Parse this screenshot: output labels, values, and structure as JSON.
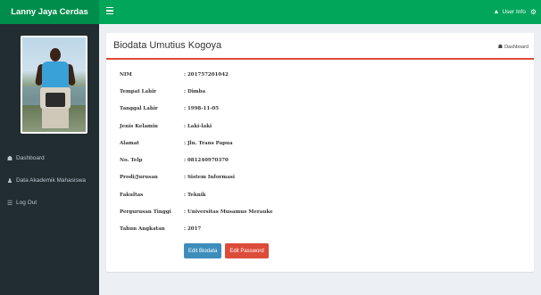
{
  "app": {
    "brand": "Lanny Jaya Cerdas"
  },
  "header": {
    "user_icon": "user-icon",
    "user_label": "User Info",
    "gear_icon": "gear-icon"
  },
  "sidebar": {
    "items": [
      {
        "icon": "dashboard-icon",
        "glyph": "☗",
        "label": "Dashboard"
      },
      {
        "icon": "users-icon",
        "glyph": "👥",
        "label": "Data Akademik Mahasiswa"
      },
      {
        "icon": "list-icon",
        "glyph": "☰",
        "label": "Log Out"
      }
    ]
  },
  "main": {
    "title": "Biodata Umutius Kogoya",
    "breadcrumb": {
      "icon": "dashboard-icon",
      "label": "Dashboard"
    },
    "fields": [
      {
        "label": "NIM",
        "value": ": 201757201042"
      },
      {
        "label": "Tempat Lahir",
        "value": ": Dimba"
      },
      {
        "label": "Tanggal Lahir",
        "value": ": 1998-11-05"
      },
      {
        "label": "Jenis Kelamin",
        "value": ": Laki-laki"
      },
      {
        "label": "Alamat",
        "value": ": Jln. Trans Papua"
      },
      {
        "label": "No. Telp",
        "value": ": 081240970370"
      },
      {
        "label": "Prodi/Jurusan",
        "value": ": Sistem Informasi"
      },
      {
        "label": "Fakultas",
        "value": ": Teknik"
      },
      {
        "label": "Pergurusan Tinggi",
        "value": ": Universitas Musamus Merauke"
      },
      {
        "label": "Tahun Angkatan",
        "value": ": 2017"
      }
    ],
    "buttons": {
      "edit": "Edit Biodata",
      "password": "Edit Password"
    }
  },
  "colors": {
    "topbar": "#00a65a",
    "brand_bg": "#008d4c",
    "sidebar": "#222d32",
    "header_border": "#dd4b39",
    "btn_primary": "#3c8dbc",
    "btn_danger": "#dd4b39"
  }
}
